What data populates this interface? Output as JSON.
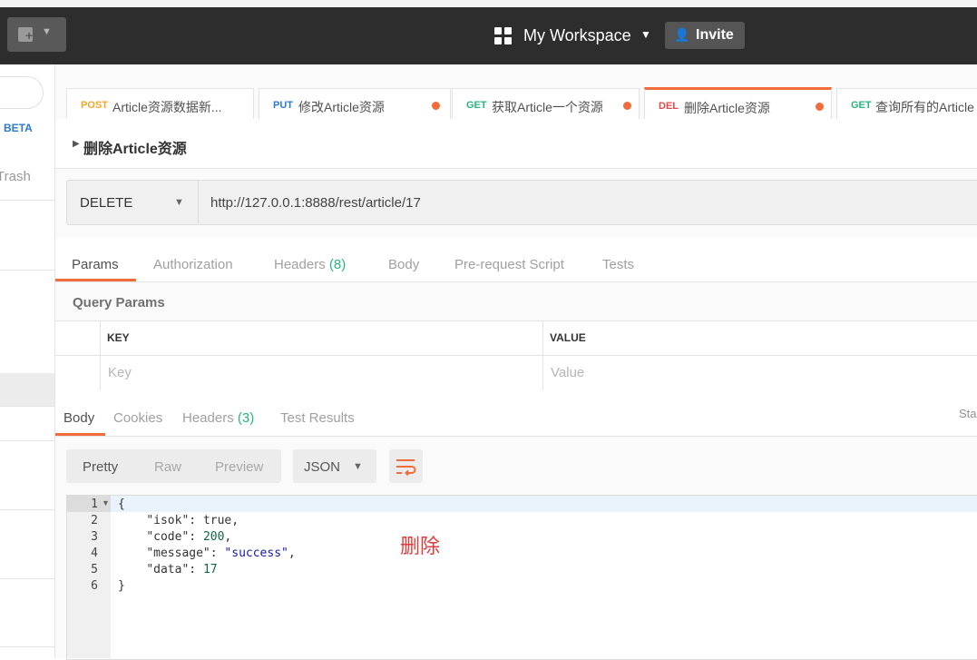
{
  "header": {
    "workspace_title": "My Workspace",
    "invite_label": "Invite"
  },
  "sidebar": {
    "beta_label": "BETA",
    "trash_label": "Trash"
  },
  "tabs": [
    {
      "method": "POST",
      "method_color": "#f5a623",
      "name": "Article资源数据新...",
      "modified": false
    },
    {
      "method": "PUT",
      "method_color": "#2a7bd0",
      "name": "修改Article资源",
      "modified": true
    },
    {
      "method": "GET",
      "method_color": "#26b47f",
      "name": "获取Article一个资源",
      "modified": true
    },
    {
      "method": "DEL",
      "method_color": "#e04a4a",
      "name": "删除Article资源",
      "modified": true,
      "active": true
    },
    {
      "method": "GET",
      "method_color": "#26b47f",
      "name": "查询所有的Article",
      "modified": false
    }
  ],
  "request": {
    "title": "删除Article资源",
    "method": "DELETE",
    "url": "http://127.0.0.1:8888/rest/article/17"
  },
  "request_tabs": {
    "params": "Params",
    "authorization": "Authorization",
    "headers": "Headers",
    "headers_count": "(8)",
    "body": "Body",
    "prerequest": "Pre-request Script",
    "tests": "Tests"
  },
  "query_params": {
    "label": "Query Params",
    "key_header": "KEY",
    "value_header": "VALUE",
    "key_placeholder": "Key",
    "value_placeholder": "Value"
  },
  "response_tabs": {
    "body": "Body",
    "cookies": "Cookies",
    "headers": "Headers",
    "headers_count": "(3)",
    "test_results": "Test Results",
    "status_partial": "Sta"
  },
  "format": {
    "pretty": "Pretty",
    "raw": "Raw",
    "preview": "Preview",
    "type": "JSON"
  },
  "code": {
    "line_numbers": [
      "1",
      "2",
      "3",
      "4",
      "5",
      "6"
    ],
    "open_brace": "{",
    "close_brace": "}",
    "isok_key": "\"isok\"",
    "isok_val": "true",
    "code_key": "\"code\"",
    "code_val": "200",
    "message_key": "\"message\"",
    "message_val": "\"success\"",
    "data_key": "\"data\"",
    "data_val": "17"
  },
  "annotation": "删除",
  "colors": {
    "accent": "#f26b3a",
    "header_bg": "#2d2d2d",
    "count_green": "#26b47f"
  }
}
